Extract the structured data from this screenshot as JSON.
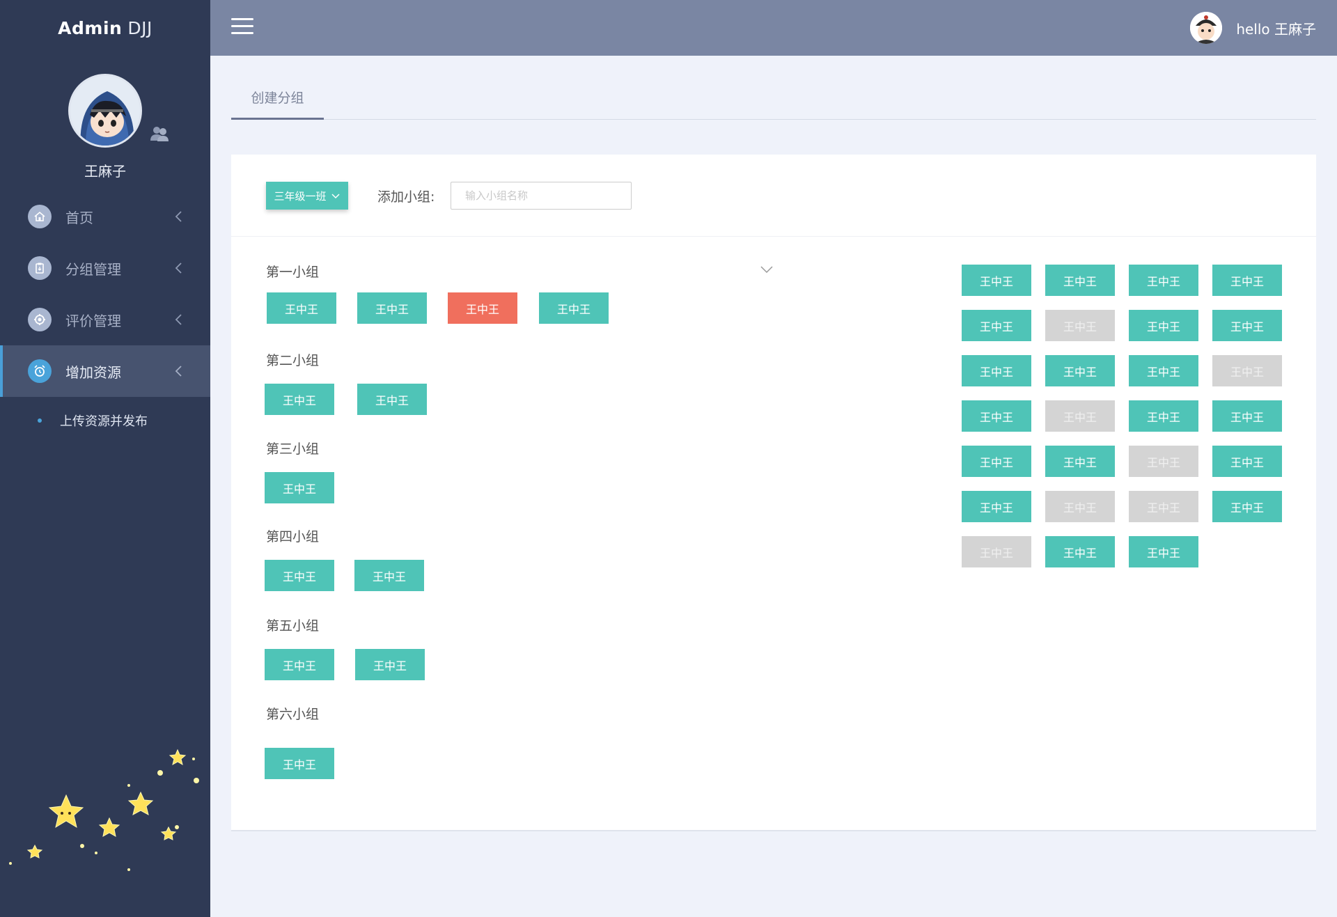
{
  "brand": {
    "bold": "Admin",
    "light": "DJJ"
  },
  "sidebar": {
    "user_name": "王麻子",
    "menu": [
      {
        "label": "首页",
        "icon": "home-icon"
      },
      {
        "label": "分组管理",
        "icon": "clipboard-icon"
      },
      {
        "label": "评价管理",
        "icon": "settings-icon"
      },
      {
        "label": "增加资源",
        "icon": "alarm-icon",
        "active": true
      }
    ],
    "submenu": {
      "label": "上传资源并发布"
    }
  },
  "topbar": {
    "hello": "hello 王麻子"
  },
  "tabs": [
    {
      "label": "创建分组"
    }
  ],
  "toolbar": {
    "class_select": "三年级一班",
    "add_label": "添加小组:",
    "input_placeholder": "输入小组名称",
    "input_value": ""
  },
  "groups": [
    {
      "title": "第一小组",
      "members": [
        "王中王",
        "王中王",
        "王中王",
        "王中王"
      ],
      "states": [
        "normal",
        "normal",
        "selected",
        "normal"
      ]
    },
    {
      "title": "第二小组",
      "members": [
        "王中王",
        "王中王"
      ]
    },
    {
      "title": "第三小组",
      "members": [
        "王中王"
      ]
    },
    {
      "title": "第四小组",
      "members": [
        "王中王",
        "王中王"
      ]
    },
    {
      "title": "第五小组",
      "members": [
        "王中王",
        "王中王"
      ]
    },
    {
      "title": "第六小组",
      "members": [
        "王中王"
      ]
    }
  ],
  "pool": {
    "label": "王中王",
    "states": [
      [
        "available",
        "available",
        "available",
        "available"
      ],
      [
        "available",
        "assigned",
        "available",
        "available"
      ],
      [
        "available",
        "available",
        "available",
        "assigned"
      ],
      [
        "available",
        "assigned",
        "available",
        "available"
      ],
      [
        "available",
        "available",
        "assigned",
        "available"
      ],
      [
        "available",
        "assigned",
        "assigned",
        "available"
      ],
      [
        "assigned",
        "available",
        "available"
      ]
    ]
  },
  "colors": {
    "sidebar_bg": "#2f3a55",
    "topbar_bg": "#7a86a3",
    "member_normal": "#4fc4b7",
    "member_selected": "#f06f5d",
    "member_assigned": "#d4d4d4",
    "active_accent": "#4aa3da"
  }
}
